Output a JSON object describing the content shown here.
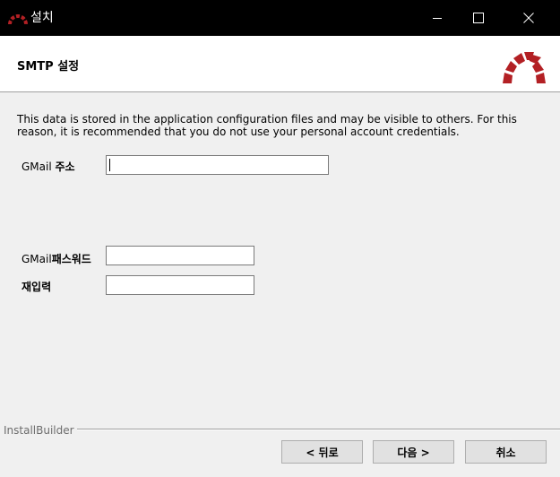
{
  "window": {
    "title": "설치",
    "minimize_icon": "minimize-icon",
    "maximize_icon": "maximize-icon",
    "close_icon": "close-icon"
  },
  "header": {
    "title": "SMTP 설정",
    "logo_icon": "redmine-logo-icon"
  },
  "description": "This data is stored in the application configuration files and may be visible to others. For this reason, it is recommended that you do not use your personal account credentials.",
  "fields": {
    "email": {
      "label_prefix": "GMail",
      "label_suffix": "주소",
      "value": ""
    },
    "password": {
      "label_prefix": "GMail",
      "label_suffix": "패스워드",
      "value": ""
    },
    "reenter": {
      "label": "재입력",
      "value": ""
    }
  },
  "footer": {
    "brand": "InstallBuilder",
    "back_label": "< 뒤로",
    "next_label": "다음 >",
    "cancel_label": "취소"
  },
  "colors": {
    "titlebar": "#000000",
    "logo_red": "#b32024",
    "background": "#f0f0f0"
  }
}
